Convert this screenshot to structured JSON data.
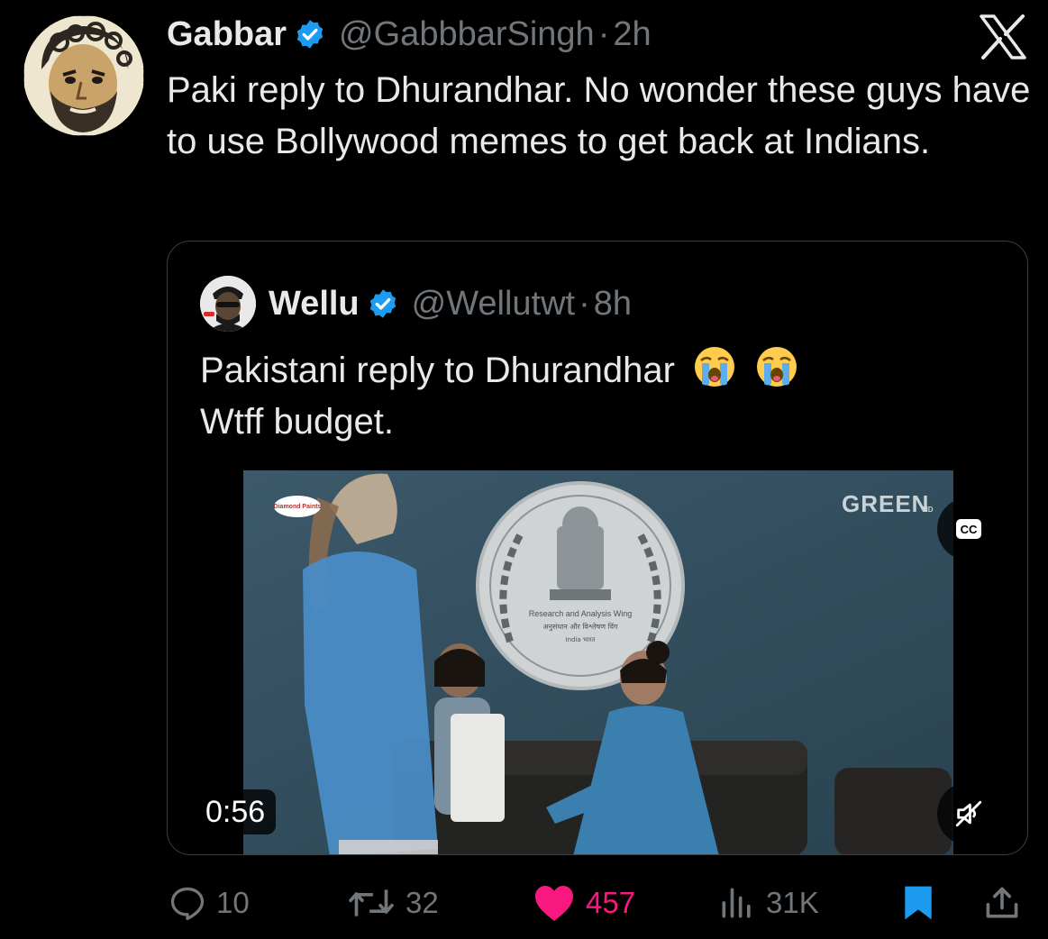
{
  "tweet": {
    "author": {
      "display_name": "Gabbar",
      "handle": "@GabbbarSingh",
      "time": "2h",
      "verified": true
    },
    "text": "Paki reply to Dhurandhar. No wonder these guys have to use Bollywood memes to get back at Indians.",
    "platform_icon": "x-logo-icon"
  },
  "quoted_tweet": {
    "author": {
      "display_name": "Wellu",
      "handle": "@Wellutwt",
      "time": "8h",
      "verified": true
    },
    "text_line1": "Pakistani reply to Dhurandhar",
    "text_line2": "Wtff budget.",
    "emojis": [
      "loudly-crying-face",
      "loudly-crying-face"
    ],
    "video": {
      "duration": "0:56",
      "cc_label": "CC",
      "watermark": "GREEN HD",
      "sponsor_logo": "Diamond Paints",
      "emblem_text_line1": "Research and Analysis Wing",
      "emblem_text_line2": "अनुसंधान और विश्लेषण विंग",
      "emblem_text_line3": "India भारत"
    }
  },
  "actions": {
    "replies": "10",
    "reposts": "32",
    "likes": "457",
    "views": "31K"
  },
  "colors": {
    "background": "#000000",
    "text_primary": "#e7e9ea",
    "text_secondary": "#71767b",
    "verified_blue": "#1d9bf0",
    "like_pink": "#f91880",
    "bookmark_blue": "#1d9bf0"
  }
}
